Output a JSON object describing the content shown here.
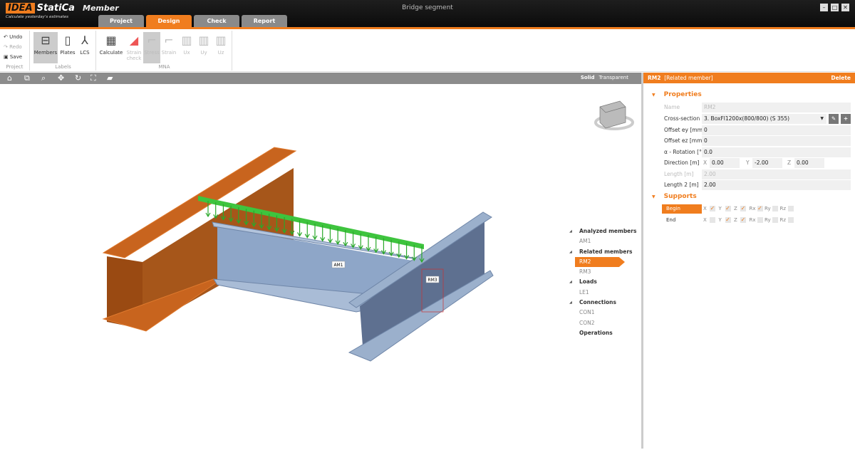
{
  "app": {
    "brand": "IDEA",
    "brand2": "StatiCa",
    "product": "Member",
    "tagline": "Calculate yesterday's estimates",
    "window_title": "Bridge segment"
  },
  "tabs": [
    {
      "label": "Project"
    },
    {
      "label": "Design",
      "active": true
    },
    {
      "label": "Check"
    },
    {
      "label": "Report"
    }
  ],
  "ribbon": {
    "project": {
      "undo": "Undo",
      "redo": "Redo",
      "save": "Save",
      "label": "Project"
    },
    "labels": {
      "members": "Members",
      "plates": "Plates",
      "lcs": "LCS",
      "label": "Labels"
    },
    "mna": {
      "calculate": "Calculate",
      "strain_check": "Strain check",
      "stress": "Stress",
      "strain": "Strain",
      "ux": "Ux",
      "uy": "Uy",
      "uz": "Uz",
      "label": "MNA"
    }
  },
  "view": {
    "solid": "Solid",
    "transparent": "Transparent"
  },
  "scene": {
    "labels": {
      "am1": "AM1",
      "rm3": "RM3"
    },
    "colors": {
      "orange_member": "#c8641e",
      "blue_member": "#8ea6c8",
      "loads": "#3ec43e"
    }
  },
  "tree": {
    "items": [
      {
        "label": "Analyzed members",
        "type": "h"
      },
      {
        "label": "AM1",
        "type": "c"
      },
      {
        "label": "Related members",
        "type": "h"
      },
      {
        "label": "RM2",
        "type": "sel"
      },
      {
        "label": "RM3",
        "type": "c"
      },
      {
        "label": "Loads",
        "type": "h"
      },
      {
        "label": "LE1",
        "type": "c"
      },
      {
        "label": "Connections",
        "type": "h"
      },
      {
        "label": "CON1",
        "type": "c"
      },
      {
        "label": "CON2",
        "type": "c"
      },
      {
        "label": "Operations",
        "type": "op"
      }
    ]
  },
  "panel": {
    "title": "RM2",
    "subtitle": "[Related member]",
    "delete": "Delete",
    "properties_title": "Properties",
    "name_label": "Name",
    "name": "RM2",
    "cross_section_label": "Cross-section",
    "cross_section": "3. BoxFl1200x(800/800) (S 355)",
    "offset_ey_label": "Offset ey [mm]",
    "offset_ey": "0",
    "offset_ez_label": "Offset ez [mm]",
    "offset_ez": "0",
    "rotation_label": "α - Rotation [°]",
    "rotation": "0.0",
    "direction_label": "Direction [m]",
    "dir_x": "0.00",
    "dir_y": "-2.00",
    "dir_z": "0.00",
    "length_label": "Length [m]",
    "length": "2.00",
    "length2_label": "Length 2 [m]",
    "length2": "2.00",
    "supports_title": "Supports",
    "supports": [
      {
        "name": "Begin",
        "X": true,
        "Y": true,
        "Z": true,
        "Rx": true,
        "Ry": false,
        "Rz": false
      },
      {
        "name": "End",
        "X": false,
        "Y": true,
        "Z": true,
        "Rx": false,
        "Ry": false,
        "Rz": false
      }
    ]
  },
  "accent": "#f07d1e"
}
